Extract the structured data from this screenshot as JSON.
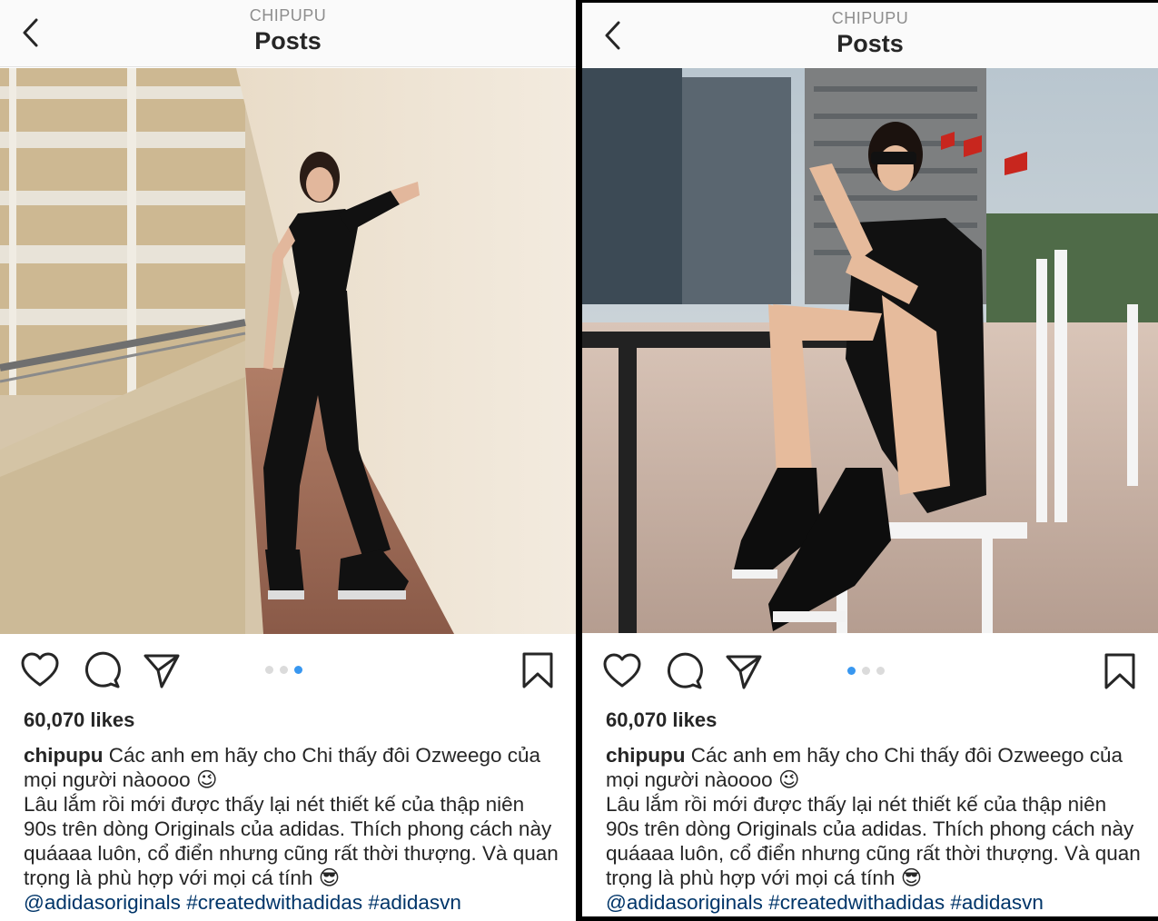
{
  "colors": {
    "accent": "#3897f0",
    "hashtag": "#003569",
    "text": "#262626",
    "muted": "#8e8e8e",
    "dot_inactive": "#dbdbdb"
  },
  "posts": [
    {
      "header": {
        "username": "CHIPUPU",
        "title": "Posts"
      },
      "carousel": {
        "count": 3,
        "active_index": 2
      },
      "likes": "60,070 likes",
      "caption": {
        "username": "chipupu",
        "line1": "Các anh em hãy cho Chi thấy đôi Ozweego của mọi người nàoooo",
        "emoji1": "😉",
        "line2": "Lâu lắm rồi mới được thấy lại nét thiết kế của thập niên 90s trên dòng Originals của adidas. Thích phong cách này quáaaa luôn, cổ điển nhưng cũng rất thời thượng. Và quan trọng là phù hợp với mọi cá tính",
        "emoji2": "😎",
        "tags": [
          "@adidasoriginals",
          "#createdwithadidas",
          "#adidasvn"
        ]
      }
    },
    {
      "header": {
        "username": "CHIPUPU",
        "title": "Posts"
      },
      "carousel": {
        "count": 3,
        "active_index": 0
      },
      "likes": "60,070 likes",
      "caption": {
        "username": "chipupu",
        "line1": "Các anh em hãy cho Chi thấy đôi Ozweego của mọi người nàoooo",
        "emoji1": "😉",
        "line2": "Lâu lắm rồi mới được thấy lại nét thiết kế của thập niên 90s trên dòng Originals của adidas. Thích phong cách này quáaaa luôn, cổ điển nhưng cũng rất thời thượng. Và quan trọng là phù hợp với mọi cá tính",
        "emoji2": "😎",
        "tags": [
          "@adidasoriginals",
          "#createdwithadidas",
          "#adidasvn"
        ]
      }
    }
  ]
}
